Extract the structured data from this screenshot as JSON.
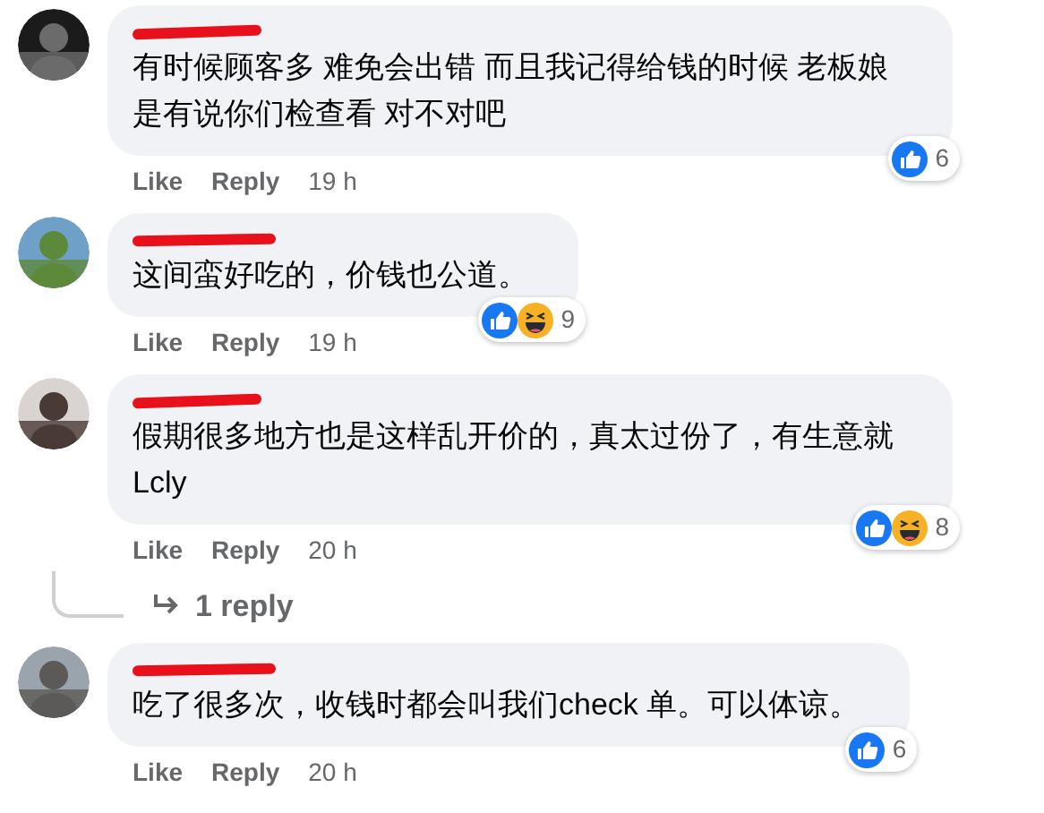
{
  "comments": [
    {
      "text": "有时候顾客多 难免会出错 而且我记得给钱的时候 老板娘是有说你们检查看 对不对吧",
      "reactions": [
        {
          "kind": "like"
        }
      ],
      "reaction_count": "6",
      "actions": [
        "Like",
        "Reply"
      ],
      "time": "19 h"
    },
    {
      "text": "这间蛮好吃的，价钱也公道。",
      "reactions": [
        {
          "kind": "like"
        },
        {
          "kind": "haha"
        }
      ],
      "reaction_count": "9",
      "actions": [
        "Like",
        "Reply"
      ],
      "time": "19 h"
    },
    {
      "text": "假期很多地方也是这样乱开价的，真太过份了，有生意就Lcly",
      "reactions": [
        {
          "kind": "like"
        },
        {
          "kind": "haha"
        }
      ],
      "reaction_count": "8",
      "actions": [
        "Like",
        "Reply"
      ],
      "time": "20 h",
      "replies": "1 reply"
    },
    {
      "text": "吃了很多次，收钱时都会叫我们check 单。可以体谅。",
      "reactions": [
        {
          "kind": "like"
        }
      ],
      "reaction_count": "6",
      "actions": [
        "Like",
        "Reply"
      ],
      "time": "20 h"
    }
  ]
}
